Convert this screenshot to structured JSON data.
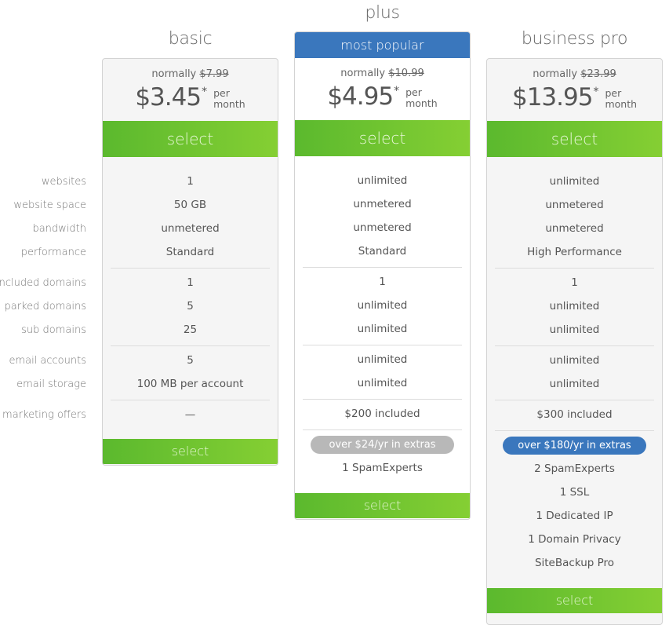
{
  "feature_labels": [
    "websites",
    "website space",
    "bandwidth",
    "performance",
    "included domains",
    "parked domains",
    "sub domains",
    "email accounts",
    "email storage",
    "marketing offers"
  ],
  "plans": [
    {
      "name": "basic",
      "normally_label": "normally",
      "normal_price": "$7.99",
      "price": "$3.45",
      "asterisk": "*",
      "per": "per",
      "period": "month",
      "select_label": "select",
      "features": [
        "1",
        "50 GB",
        "unmetered",
        "Standard",
        "1",
        "5",
        "25",
        "5",
        "100 MB per account",
        "—"
      ]
    },
    {
      "name": "plus",
      "ribbon": "most popular",
      "normally_label": "normally",
      "normal_price": "$10.99",
      "price": "$4.95",
      "asterisk": "*",
      "per": "per",
      "period": "month",
      "select_label": "select",
      "features": [
        "unlimited",
        "unmetered",
        "unmetered",
        "Standard",
        "1",
        "unlimited",
        "unlimited",
        "unlimited",
        "unlimited",
        "$200 included"
      ],
      "extras_badge": "over $24/yr in extras",
      "extras": [
        "1 SpamExperts"
      ]
    },
    {
      "name": "business pro",
      "normally_label": "normally",
      "normal_price": "$23.99",
      "price": "$13.95",
      "asterisk": "*",
      "per": "per",
      "period": "month",
      "select_label": "select",
      "features": [
        "unlimited",
        "unmetered",
        "unmetered",
        "High Performance",
        "1",
        "unlimited",
        "unlimited",
        "unlimited",
        "unlimited",
        "$300 included"
      ],
      "extras_badge": "over $180/yr in extras",
      "extras": [
        "2 SpamExperts",
        "1 SSL",
        "1 Dedicated IP",
        "1 Domain Privacy",
        "SiteBackup Pro"
      ]
    }
  ],
  "colors": {
    "select_green_start": "#5bb92e",
    "select_green_end": "#85cf33",
    "popular_blue": "#3a77bd",
    "badge_gray": "#b8b8b8"
  }
}
